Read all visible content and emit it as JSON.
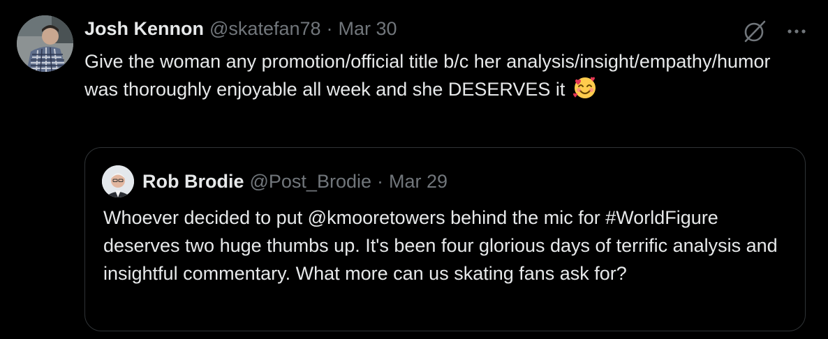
{
  "tweet": {
    "author_name": "Josh Kennon",
    "author_handle": "@skatefan78",
    "separator": "·",
    "date": "Mar 30",
    "text": "Give the woman any promotion/official title b/c her analysis/insight/empathy/humor was thoroughly enjoyable all week and she DESERVES it",
    "emoji": "smiling-face-with-hearts",
    "icons": {
      "grok": "grok-icon",
      "more": "more-icon"
    }
  },
  "quoted_tweet": {
    "author_name": "Rob Brodie",
    "author_handle": "@Post_Brodie",
    "separator": "·",
    "date": "Mar 29",
    "text": "Whoever decided to put @kmooretowers behind the mic for #WorldFigure deserves two huge thumbs up. It's been four glorious days of terrific analysis and insightful commentary. What more can us skating fans ask for?"
  },
  "colors": {
    "background": "#000000",
    "primary_text": "#e7e9ea",
    "secondary_text": "#71767b",
    "border": "#2f3336"
  }
}
